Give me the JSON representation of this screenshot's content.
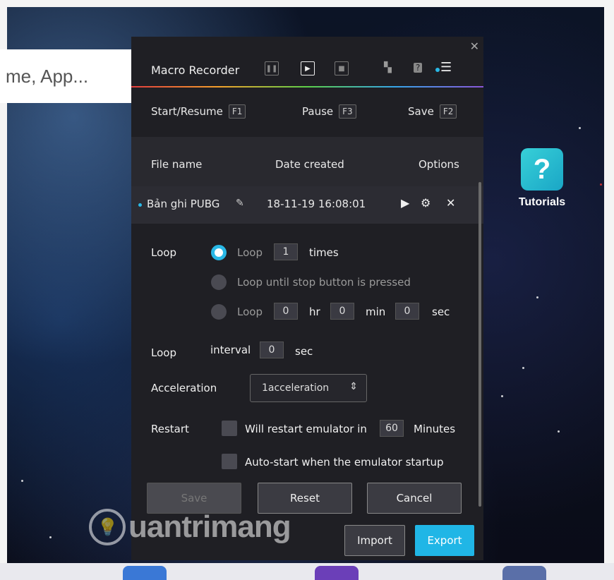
{
  "desktop": {
    "search_placeholder": "me, App...",
    "app_icon_label": "Tutorials"
  },
  "macro": {
    "title": "Macro Recorder",
    "shortcuts": [
      {
        "label": "Start/Resume",
        "key": "F1"
      },
      {
        "label": "Pause",
        "key": "F3"
      },
      {
        "label": "Save",
        "key": "F2"
      }
    ],
    "columns": {
      "file_name": "File name",
      "date_created": "Date created",
      "options": "Options"
    },
    "file": {
      "name": "Bản ghi PUBG",
      "date": "18-11-19 16:08:01"
    },
    "loop_section": {
      "label": "Loop",
      "option1_prefix": "Loop",
      "option1_times": "1",
      "option1_suffix": "times",
      "option2": "Loop until stop button is pressed",
      "option3_prefix": "Loop",
      "hr_value": "0",
      "hr_label": "hr",
      "min_value": "0",
      "min_label": "min",
      "sec_value": "0",
      "sec_label": "sec"
    },
    "interval": {
      "label": "Loop",
      "sub": "interval",
      "value": "0",
      "unit": "sec"
    },
    "acceleration": {
      "label": "Acceleration",
      "value": "1acceleration"
    },
    "restart": {
      "label": "Restart",
      "text": "Will restart emulator in",
      "minutes_value": "60",
      "minutes_label": "Minutes",
      "autostart": "Auto-start when the emulator startup"
    },
    "buttons": {
      "save": "Save",
      "reset": "Reset",
      "cancel": "Cancel",
      "import": "Import",
      "export": "Export"
    }
  },
  "watermark": {
    "text": "uantrimang"
  },
  "colors": {
    "accent": "#29b8e6",
    "panel": "#1f1f24"
  }
}
